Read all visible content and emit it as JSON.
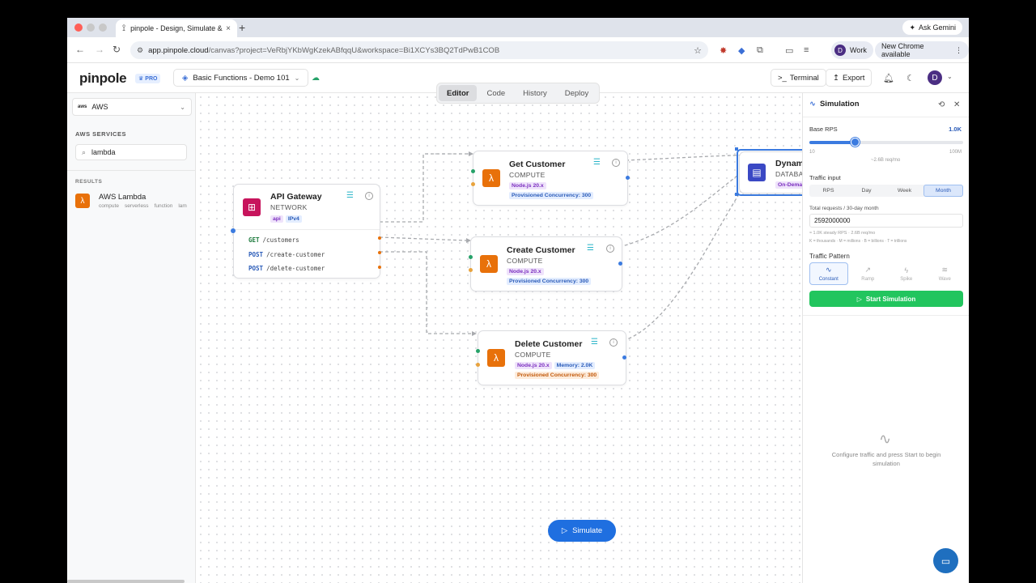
{
  "browser": {
    "tab_title": "pinpole - Design, Simulate &",
    "tab_close": "×",
    "new_tab": "+",
    "ask_gemini": "Ask Gemini",
    "url_host": "app.pinpole.cloud",
    "url_path": "/canvas?project=VeRbjYKbWgKzekABfqqU&workspace=Bi1XCYs3BQ2TdPwB1COB",
    "profile_initial": "D",
    "profile_label": "Work",
    "new_chrome": "New Chrome available"
  },
  "app": {
    "logo": "pinpole",
    "plan_badge": "PRO",
    "project_name": "Basic Functions - Demo 101",
    "terminal_label": "Terminal",
    "export_label": "Export",
    "user_initial": "D"
  },
  "mode_tabs": [
    {
      "label": "Editor",
      "active": true
    },
    {
      "label": "Code",
      "active": false
    },
    {
      "label": "History",
      "active": false
    },
    {
      "label": "Deploy",
      "active": false
    }
  ],
  "sidebar": {
    "provider_logo": "aws",
    "provider": "AWS",
    "section_title": "AWS SERVICES",
    "search_value": "lambda",
    "results_title": "RESULTS",
    "results": [
      {
        "name": "AWS Lambda",
        "tags": [
          "compute",
          "serverless",
          "function",
          "lam"
        ]
      }
    ]
  },
  "nodes": {
    "api_gateway": {
      "title": "API Gateway",
      "category": "NETWORK",
      "tags": [
        "api",
        "IPv4"
      ],
      "routes": [
        {
          "method": "GET",
          "path": "/customers"
        },
        {
          "method": "POST",
          "path": "/create-customer"
        },
        {
          "method": "POST",
          "path": "/delete-customer"
        }
      ]
    },
    "get_customer": {
      "title": "Get Customer",
      "category": "COMPUTE",
      "tags": [
        "Node.js 20.x",
        "Provisioned Concurrency: 300"
      ]
    },
    "create_customer": {
      "title": "Create Customer",
      "category": "COMPUTE",
      "tags": [
        "Node.js 20.x",
        "Provisioned Concurrency: 300"
      ]
    },
    "delete_customer": {
      "title": "Delete Customer",
      "category": "COMPUTE",
      "tags": [
        "Node.js 20.x",
        "Memory: 2.0K",
        "Provisioned Concurrency: 300"
      ]
    },
    "dynamo": {
      "title": "Dynam",
      "category": "DATABA",
      "tags": [
        "On-Dema"
      ]
    }
  },
  "simulate_label": "Simulate",
  "panel": {
    "title": "Simulation",
    "base_rps_label": "Base RPS",
    "base_rps_value": "1.0K",
    "slider_fraction": 0.3,
    "slider_min": "10",
    "slider_max": "100M",
    "slider_hint": "~2.6B req/mo",
    "traffic_input_label": "Traffic input",
    "traffic_tabs": [
      {
        "label": "RPS",
        "active": false
      },
      {
        "label": "Day",
        "active": false
      },
      {
        "label": "Week",
        "active": false
      },
      {
        "label": "Month",
        "active": true
      }
    ],
    "total_requests_label": "Total requests / 30-day month",
    "total_requests_value": "2592000000",
    "steady_hint": "≈ 1.0K steady RPS · 2.6B req/mo",
    "units_hint": "K = thousands · M = millions · B = billions · T = trillions",
    "pattern_label": "Traffic Pattern",
    "patterns": [
      {
        "label": "Constant",
        "active": true
      },
      {
        "label": "Ramp",
        "active": false
      },
      {
        "label": "Spike",
        "active": false
      },
      {
        "label": "Wave",
        "active": false
      }
    ],
    "start_label": "Start Simulation",
    "empty_text": "Configure traffic and press Start to begin simulation"
  },
  "colors": {
    "accent": "#3b7be0",
    "start_green": "#22c55e",
    "lambda_orange": "#e8710a",
    "apigw_pink": "#c7145c",
    "dynamo_blue": "#3a48c4"
  }
}
